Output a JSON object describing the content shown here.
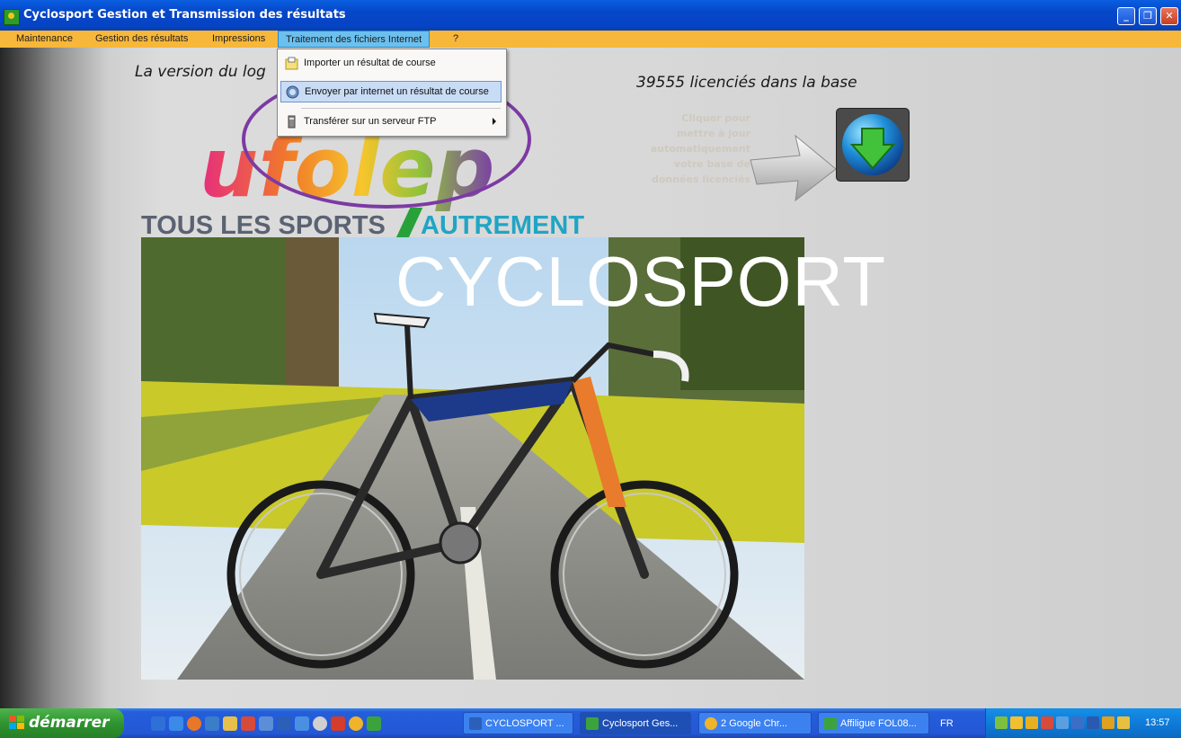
{
  "window": {
    "title": "Cyclosport Gestion et Transmission des résultats",
    "controls": {
      "minimize": "_",
      "maximize": "❐",
      "close": "✕"
    }
  },
  "menu": {
    "items": [
      "Maintenance",
      "Gestion des résultats",
      "Impressions",
      "Traitement des fichiers Internet",
      "?"
    ],
    "active_index": 3,
    "dropdown": [
      {
        "label": "Importer un résultat de course",
        "icon": "import-icon"
      },
      {
        "label": "Envoyer par internet un résultat de course",
        "icon": "internet-icon",
        "highlighted": true
      },
      {
        "label": "Transférer sur un serveur  FTP",
        "icon": "ftp-icon",
        "submenu": true
      }
    ]
  },
  "main": {
    "version_text": "La version  du log",
    "licence_count": "39555 licenciés dans la base",
    "update_hint": [
      "Cliquer pour",
      "mettre à jour",
      "automatiquement",
      "votre base de",
      "données licenciés"
    ],
    "logo_text": "ufolep",
    "tagline_part1": "TOUS LES SPORTS",
    "tagline_part2": "AUTREMENT",
    "banner": "CYCLOSPORT"
  },
  "taskbar": {
    "start_label": "démarrer",
    "quick_launch_icons": [
      "ie-icon",
      "ie-icon",
      "firefox-icon",
      "outlook-icon",
      "explorer-icon",
      "folder-icon",
      "calc-icon",
      "word-icon",
      "ie-icon",
      "media-icon",
      "acrobat-icon",
      "chrome-icon",
      "app-icon"
    ],
    "buttons": [
      {
        "label": "CYCLOSPORT ...",
        "icon": "word-icon",
        "active": false
      },
      {
        "label": "Cyclosport Ges...",
        "icon": "app-icon",
        "active": true
      },
      {
        "label": "2 Google Chr...",
        "icon": "chrome-icon",
        "active": false
      },
      {
        "label": "Affiligue FOL08...",
        "icon": "app-icon",
        "active": false
      }
    ],
    "language": "FR",
    "clock": "13:57"
  },
  "colors": {
    "menubar": "#f7b73a",
    "highlight_oval": "#7c3aa3",
    "titlebar": "#0646c8"
  }
}
